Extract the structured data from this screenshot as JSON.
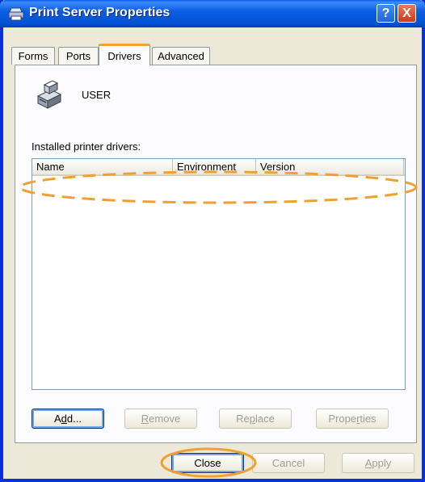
{
  "window": {
    "title": "Print Server Properties",
    "help_glyph": "?",
    "close_glyph": "X"
  },
  "tabs": [
    {
      "label": "Forms"
    },
    {
      "label": "Ports"
    },
    {
      "label": "Drivers"
    },
    {
      "label": "Advanced"
    }
  ],
  "active_tab": "Drivers",
  "server": {
    "name": "USER"
  },
  "drivers_list": {
    "caption": "Installed printer drivers:",
    "columns": [
      "Name",
      "Environment",
      "Version"
    ],
    "rows": []
  },
  "driver_buttons": {
    "add": {
      "pre": "A",
      "key": "d",
      "post": "d..."
    },
    "remove": {
      "pre": "",
      "key": "R",
      "post": "emove"
    },
    "replace": {
      "pre": "Re",
      "key": "p",
      "post": "lace"
    },
    "properties": {
      "pre": "Prope",
      "key": "r",
      "post": "ties"
    }
  },
  "dialog_buttons": {
    "close": "Close",
    "cancel": "Cancel",
    "apply": {
      "pre": "",
      "key": "A",
      "post": "pply"
    }
  },
  "colors": {
    "titlebar": "#0054e3",
    "annotation": "#f0a030",
    "active_tab_accent": "#f1a33a"
  }
}
